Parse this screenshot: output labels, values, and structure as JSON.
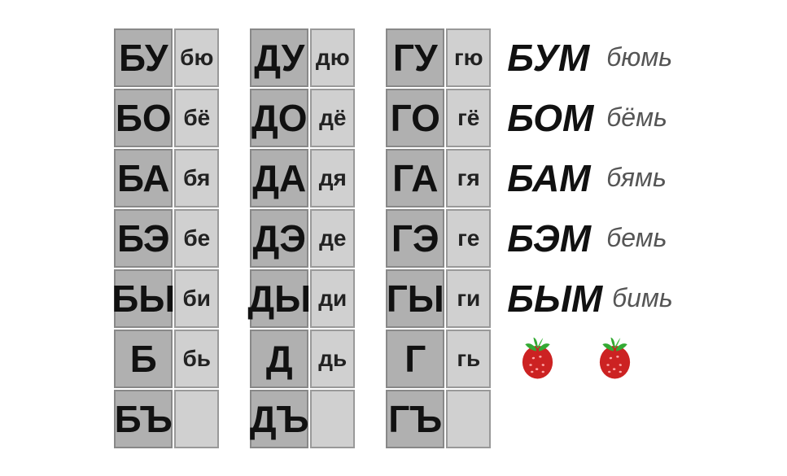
{
  "col_b": {
    "large": [
      "БУ",
      "БО",
      "БА",
      "БЭ",
      "БЫ",
      "Б",
      "БЪ"
    ],
    "small": [
      "бю",
      "бё",
      "бя",
      "бе",
      "би",
      "бь",
      ""
    ]
  },
  "col_d": {
    "large": [
      "ДУ",
      "ДО",
      "ДА",
      "ДЭ",
      "ДЫ",
      "Д",
      "ДЪ"
    ],
    "small": [
      "дю",
      "дё",
      "дя",
      "де",
      "ди",
      "дь",
      ""
    ]
  },
  "col_g": {
    "large": [
      "ГУ",
      "ГО",
      "ГА",
      "ГЭ",
      "ГЫ",
      "Г",
      "ГЪ"
    ],
    "small": [
      "гю",
      "гё",
      "гя",
      "ге",
      "ги",
      "гь",
      ""
    ]
  },
  "words": [
    {
      "bold": "БУМ",
      "light": "бюмь"
    },
    {
      "bold": "БОМ",
      "light": "бёмь"
    },
    {
      "bold": "БАМ",
      "light": "бямь"
    },
    {
      "bold": "БЭМ",
      "light": "бемь"
    },
    {
      "bold": "БЫМ",
      "light": "бимь"
    },
    {
      "strawberries": true
    }
  ]
}
